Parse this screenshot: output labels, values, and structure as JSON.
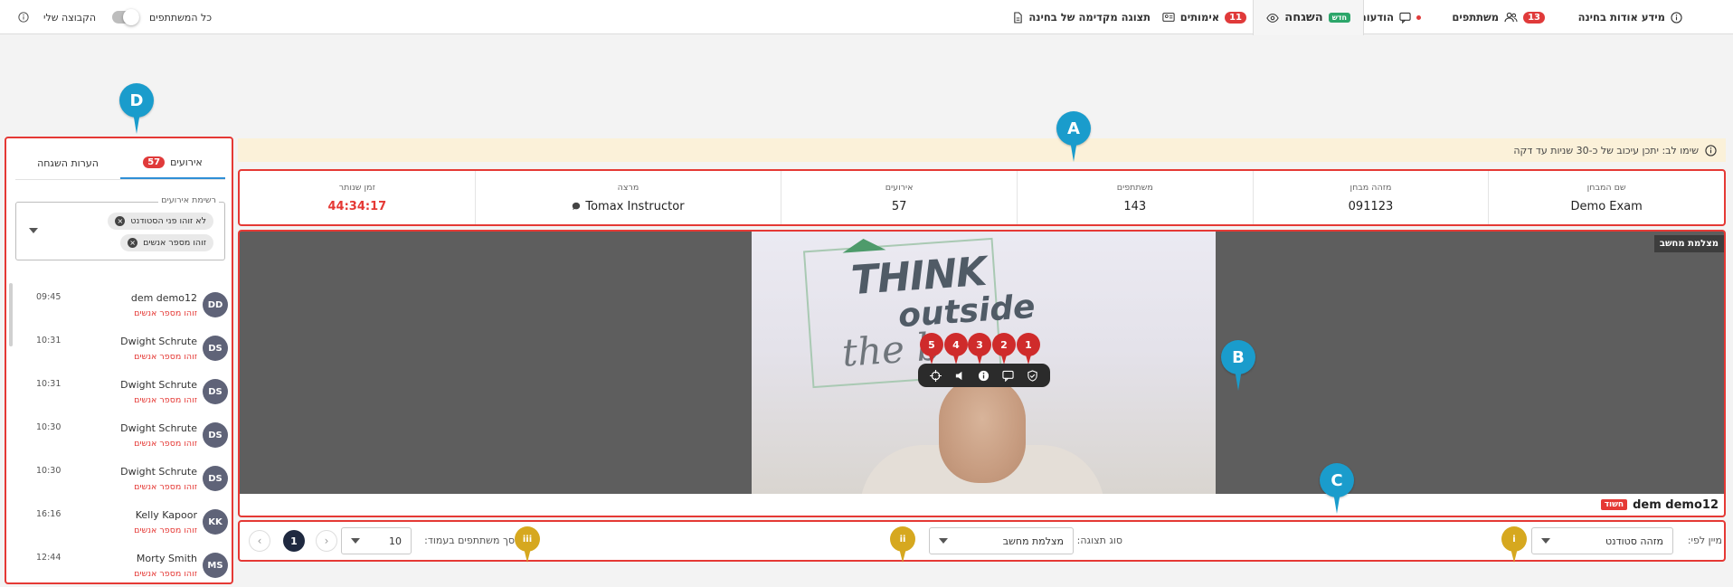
{
  "nav": {
    "exam_info": "מידע אודות בחינה",
    "participants": "משתתפים",
    "participants_count": "13",
    "messages": "הודעות",
    "proctoring": "השגחה",
    "new_badge": "חדש",
    "verifications": "אימותים",
    "verifications_count": "11",
    "exam_preview": "תצוגה מקדימה של בחינה",
    "all_participants": "כל המשתתפים",
    "my_group": "הקבוצה שלי"
  },
  "banner": {
    "text": "שימו לב: יתכן עיכוב של כ-30 שניות עד דקה"
  },
  "exam_info": [
    {
      "label": "שם המבחן",
      "value": "Demo Exam"
    },
    {
      "label": "מזהה מבחן",
      "value": "091123"
    },
    {
      "label": "משתתפים",
      "value": "143"
    },
    {
      "label": "אירועים",
      "value": "57"
    },
    {
      "label": "מרצה",
      "value": "Tomax Instructor"
    },
    {
      "label": "זמן שנותר",
      "value": "44:34:17"
    }
  ],
  "video": {
    "camera_label": "מצלמת מחשב",
    "participant_name": "dem demo12",
    "suspicious_badge": "חשוד",
    "numbered_pins": [
      "5",
      "4",
      "3",
      "2",
      "1"
    ]
  },
  "controls": {
    "sort_label": "מיין לפי:",
    "sort_value": "מזהה סטודנט",
    "view_label": "סוג תצוגה:",
    "view_value": "מצלמת מחשב",
    "per_page_label": "סך משתתפים בעמוד:",
    "per_page_value": "10",
    "current_page": "1"
  },
  "callouts": {
    "a": "A",
    "b": "B",
    "c": "C",
    "d": "D",
    "i": "i",
    "ii": "ii",
    "iii": "iii"
  },
  "left_panel": {
    "tab_events": "אירועים",
    "tab_events_count": "57",
    "tab_notes": "הערות השגחה",
    "filter_legend": "רשימת אירועים",
    "chips": [
      "לא זוהו פני הסטודנט",
      "זוהו מספר אנשים"
    ],
    "events": [
      {
        "initials": "DD",
        "name": "dem demo12",
        "type": "זוהו מספר אנשים",
        "time": "09:45"
      },
      {
        "initials": "DS",
        "name": "Dwight Schrute",
        "type": "זוהו מספר אנשים",
        "time": "10:31"
      },
      {
        "initials": "DS",
        "name": "Dwight Schrute",
        "type": "זוהו מספר אנשים",
        "time": "10:31"
      },
      {
        "initials": "DS",
        "name": "Dwight Schrute",
        "type": "זוהו מספר אנשים",
        "time": "10:30"
      },
      {
        "initials": "DS",
        "name": "Dwight Schrute",
        "type": "זוהו מספר אנשים",
        "time": "10:30"
      },
      {
        "initials": "KK",
        "name": "Kelly Kapoor",
        "type": "זוהו מספר אנשים",
        "time": "16:16"
      },
      {
        "initials": "MS",
        "name": "Morty Smith",
        "type": "זוהו מספר אנשים",
        "time": "12:44"
      }
    ]
  },
  "colors": {
    "accent_red": "#e53935",
    "pin_blue": "#1a9ccc",
    "pin_gold": "#d6a81f",
    "banner": "#fbf1d9"
  },
  "icons": [
    "info-icon",
    "users-icon",
    "chat-icon",
    "eye-icon",
    "id-card-icon",
    "file-icon",
    "target-icon",
    "speaker-icon",
    "message-icon",
    "shield-check-icon",
    "chevron-left-icon",
    "chevron-right-icon"
  ]
}
